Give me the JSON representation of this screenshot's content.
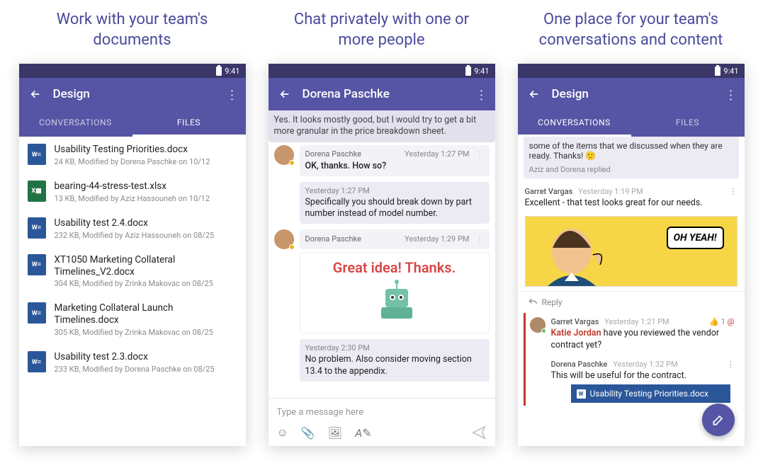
{
  "status_time": "9:41",
  "headlines": [
    "Work with your team's documents",
    "Chat privately with one or more people",
    "One place for your team's conversations and content"
  ],
  "phone1": {
    "title": "Design",
    "tabs": {
      "conversations": "CONVERSATIONS",
      "files": "FILES"
    },
    "files": [
      {
        "icon": "word",
        "name": "Usability Testing Priorities.docx",
        "meta": "24 KB, Modified by Dorena Paschke on 10/12"
      },
      {
        "icon": "excel",
        "name": "bearing-44-stress-test.xlsx",
        "meta": "13 KB, Modified by Aziz Hassouneh on 10/12"
      },
      {
        "icon": "word",
        "name": "Usability test 2.4.docx",
        "meta": "232 KB, Modified by Aziz Hassouneh on 08/25"
      },
      {
        "icon": "word",
        "name": "XT1050 Marketing Collateral Timelines_V2.docx",
        "meta": "304 KB, Modified by Zrinka Makovac on 08/25"
      },
      {
        "icon": "word",
        "name": "Marketing Collateral Launch Timelines.docx",
        "meta": "305 KB, Modified by Zrinka Makovac on 08/25"
      },
      {
        "icon": "word",
        "name": "Usability test 2.3.docx",
        "meta": "233 KB, Modified by Dorena Paschke on 08/25"
      }
    ]
  },
  "phone2": {
    "title": "Dorena Paschke",
    "partial_top": "Yes. It looks mostly good, but I would try to get a bit more granular in the price breakdown sheet.",
    "messages": [
      {
        "sender": "Dorena Paschke",
        "time": "Yesterday 1:27 PM",
        "body": "OK, thanks. How so?"
      },
      {
        "time": "Yesterday 1:27 PM",
        "body": "Specifically you should break down by part number instead of model number."
      },
      {
        "sender": "Dorena Paschke",
        "time": "Yesterday 1:29 PM",
        "sticker": "Great idea! Thanks."
      },
      {
        "time": "Yesterday 2:30 PM",
        "body": "No problem. Also consider moving section 13.4 to the appendix."
      }
    ],
    "compose_placeholder": "Type a message here"
  },
  "phone3": {
    "title": "Design",
    "tabs": {
      "conversations": "CONVERSATIONS",
      "files": "FILES"
    },
    "partial_card": "some of the items that we discussed when they are ready. Thanks! 🙂",
    "replies_note": "Aziz and Dorena replied",
    "post1": {
      "name": "Garret Vargas",
      "time": "Yesterday 1:19 PM",
      "body": "Excellent - that test looks great for our needs."
    },
    "comic_text": "OH YEAH!",
    "reply_label": "Reply",
    "post2": {
      "name": "Garret Vargas",
      "time": "Yesterday 1:21 PM",
      "likes": "1",
      "mentions": "1",
      "mention_name": "Katie Jordan",
      "body_after": " have you reviewed the vendor contract yet?"
    },
    "post3": {
      "name": "Dorena Paschke",
      "time": "Yesterday 1:32 PM",
      "body": "This will be useful for the contract."
    },
    "attachment": "Usability Testing Priorities.docx"
  }
}
